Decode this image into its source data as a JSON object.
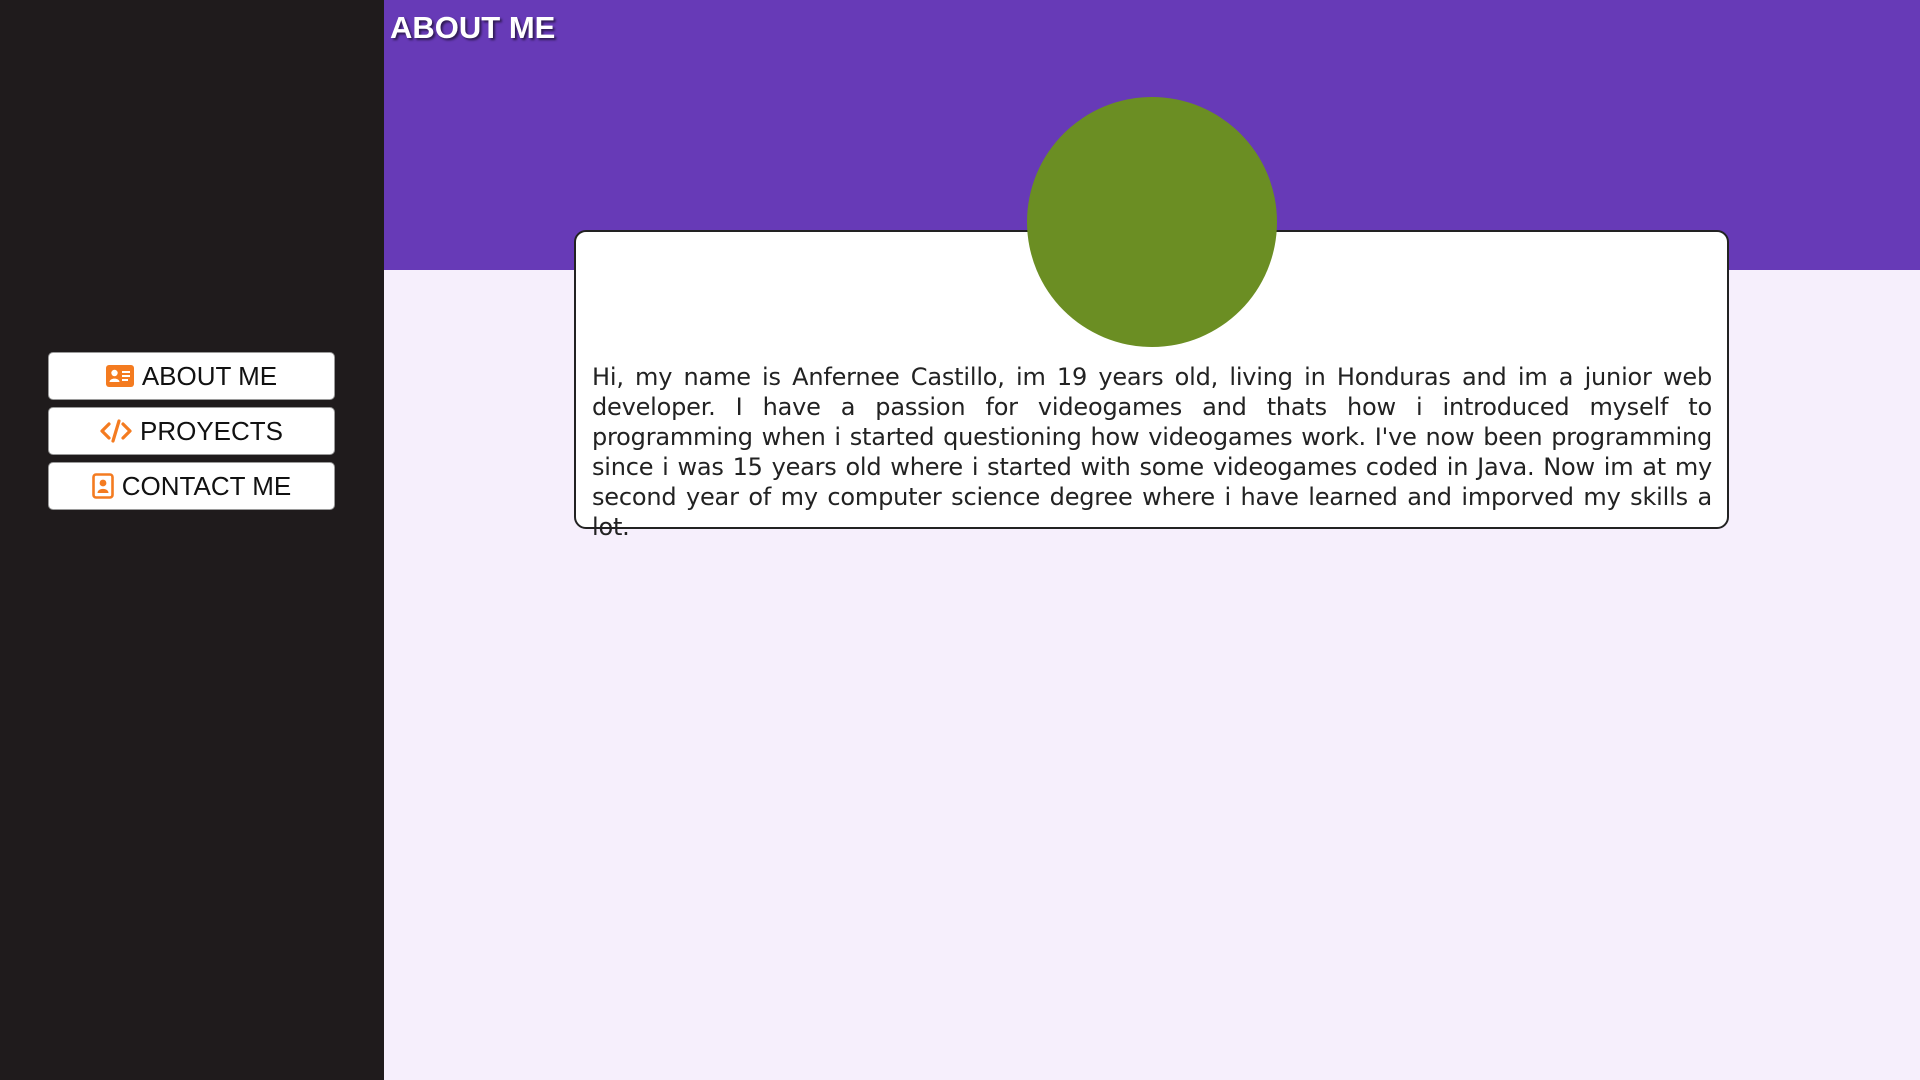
{
  "header": {
    "title": "ABOUT ME"
  },
  "sidebar": {
    "items": [
      {
        "label": "ABOUT ME",
        "icon": "id-card-icon"
      },
      {
        "label": "PROYECTS",
        "icon": "code-icon"
      },
      {
        "label": "CONTACT ME",
        "icon": "contact-book-icon"
      }
    ]
  },
  "profile": {
    "bio": "Hi, my name is Anfernee Castillo, im 19 years old, living in Honduras and im a junior web developer. I have a passion for videogames and thats how i introduced myself to programming when i started questioning how videogames work. I've now been programming since i was 15 years old where i started with some videogames coded in Java. Now im at my second year of my computer science degree where i have learned and imporved my skills a lot."
  },
  "colors": {
    "sidebar": "#1f1b1c",
    "header": "#673ab7",
    "background": "#f6effc",
    "avatar": "#6b8e23",
    "icon_accent": "#f47b20"
  }
}
